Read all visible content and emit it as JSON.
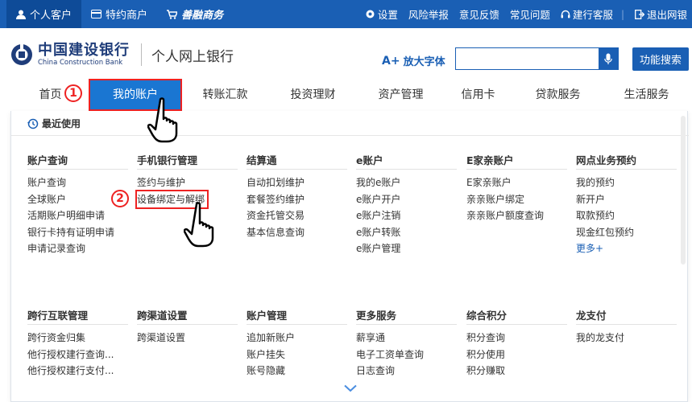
{
  "topbar": {
    "tabs": [
      {
        "label": "个人客户",
        "icon": "person-icon"
      },
      {
        "label": "特约商户",
        "icon": "card-icon"
      },
      {
        "label": "善融商务",
        "icon": "cart-icon"
      }
    ],
    "links": [
      {
        "label": "设置",
        "icon": "gear-icon"
      },
      {
        "label": "风险举报"
      },
      {
        "label": "意见反馈"
      },
      {
        "label": "常见问题"
      },
      {
        "label": "建行客服",
        "icon": "headset-icon"
      },
      {
        "label": "退出网银",
        "icon": "logout-icon"
      }
    ]
  },
  "header": {
    "logo_cn": "中国建设银行",
    "logo_en": "China Construction Bank",
    "subtitle": "个人网上银行",
    "font_size_label": "放大字体",
    "font_size_prefix": "A+",
    "search_value": "",
    "search_button": "功能搜索"
  },
  "nav": [
    "首页",
    "我的账户",
    "转账汇款",
    "投资理财",
    "资产管理",
    "信用卡",
    "贷款服务",
    "生活服务"
  ],
  "panel": {
    "recent_label": "最近使用",
    "row1": [
      {
        "title": "账户查询",
        "items": [
          "账户查询",
          "全球账户",
          "活期账户明细申请",
          "银行卡持有证明申请",
          "申请记录查询"
        ]
      },
      {
        "title": "手机银行管理",
        "items": [
          "签约与维护",
          "设备绑定与解绑"
        ]
      },
      {
        "title": "结算通",
        "items": [
          "自动扣划维护",
          "套餐签约维护",
          "资金托管交易",
          "基本信息查询"
        ]
      },
      {
        "title": "e账户",
        "items": [
          "我的e账户",
          "e账户开户",
          "e账户注销",
          "e账户转账",
          "e账户管理"
        ]
      },
      {
        "title": "E家亲账户",
        "items": [
          "E家亲账户",
          "亲亲账户绑定",
          "亲亲账户额度查询"
        ]
      },
      {
        "title": "网点业务预约",
        "items": [
          "我的预约",
          "新开户",
          "取款预约",
          "现金红包预约",
          "更多+"
        ]
      }
    ],
    "row2": [
      {
        "title": "跨行互联管理",
        "items": [
          "跨行资金归集",
          "他行授权建行查询...",
          "他行授权建行支付..."
        ]
      },
      {
        "title": "跨渠道设置",
        "items": [
          "跨渠道设置"
        ]
      },
      {
        "title": "账户管理",
        "items": [
          "追加新账户",
          "账户挂失",
          "账号隐藏"
        ]
      },
      {
        "title": "更多服务",
        "items": [
          "薪享通",
          "电子工资单查询",
          "日志查询"
        ]
      },
      {
        "title": "综合积分",
        "items": [
          "积分查询",
          "积分使用",
          "积分赚取"
        ]
      },
      {
        "title": "龙支付",
        "items": [
          "我的龙支付"
        ]
      }
    ]
  },
  "annotations": {
    "step1": "1",
    "step2": "2"
  },
  "colors": {
    "brand_blue": "#1a5fb4",
    "active_tab": "#1a76d2",
    "annotation_red": "#e22222"
  }
}
